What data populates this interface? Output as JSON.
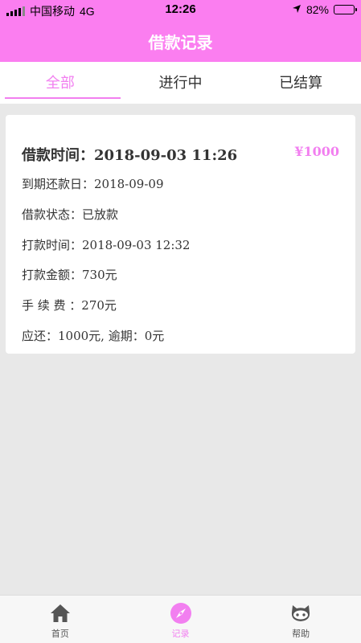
{
  "status_bar": {
    "carrier": "中国移动",
    "network": "4G",
    "time": "12:26",
    "battery": "82%",
    "battery_level": 0.82
  },
  "header": {
    "title": "借款记录"
  },
  "tabs": [
    {
      "label": "全部",
      "active": true
    },
    {
      "label": "进行中",
      "active": false
    },
    {
      "label": "已结算",
      "active": false
    }
  ],
  "record": {
    "time_line": "借款时间：2018-09-03 11:26",
    "amount": "¥1000",
    "due_line": "到期还款日：2018-09-09",
    "status_line": "借款状态：已放款",
    "pay_time_line": "打款时间：2018-09-03 12:32",
    "pay_amount_line": "打款金额：730元",
    "fee_line": "手 续 费 ：270元",
    "repay_line": "应还：1000元, 逾期：0元"
  },
  "tabbar": [
    {
      "label": "首页",
      "icon": "home-icon",
      "active": false
    },
    {
      "label": "记录",
      "icon": "compass-icon",
      "active": true
    },
    {
      "label": "帮助",
      "icon": "github-cat-icon",
      "active": false
    }
  ],
  "colors": {
    "accent": "#f27ff0",
    "header_bg": "#fb7ef0",
    "page_bg": "#e8e8e8"
  }
}
